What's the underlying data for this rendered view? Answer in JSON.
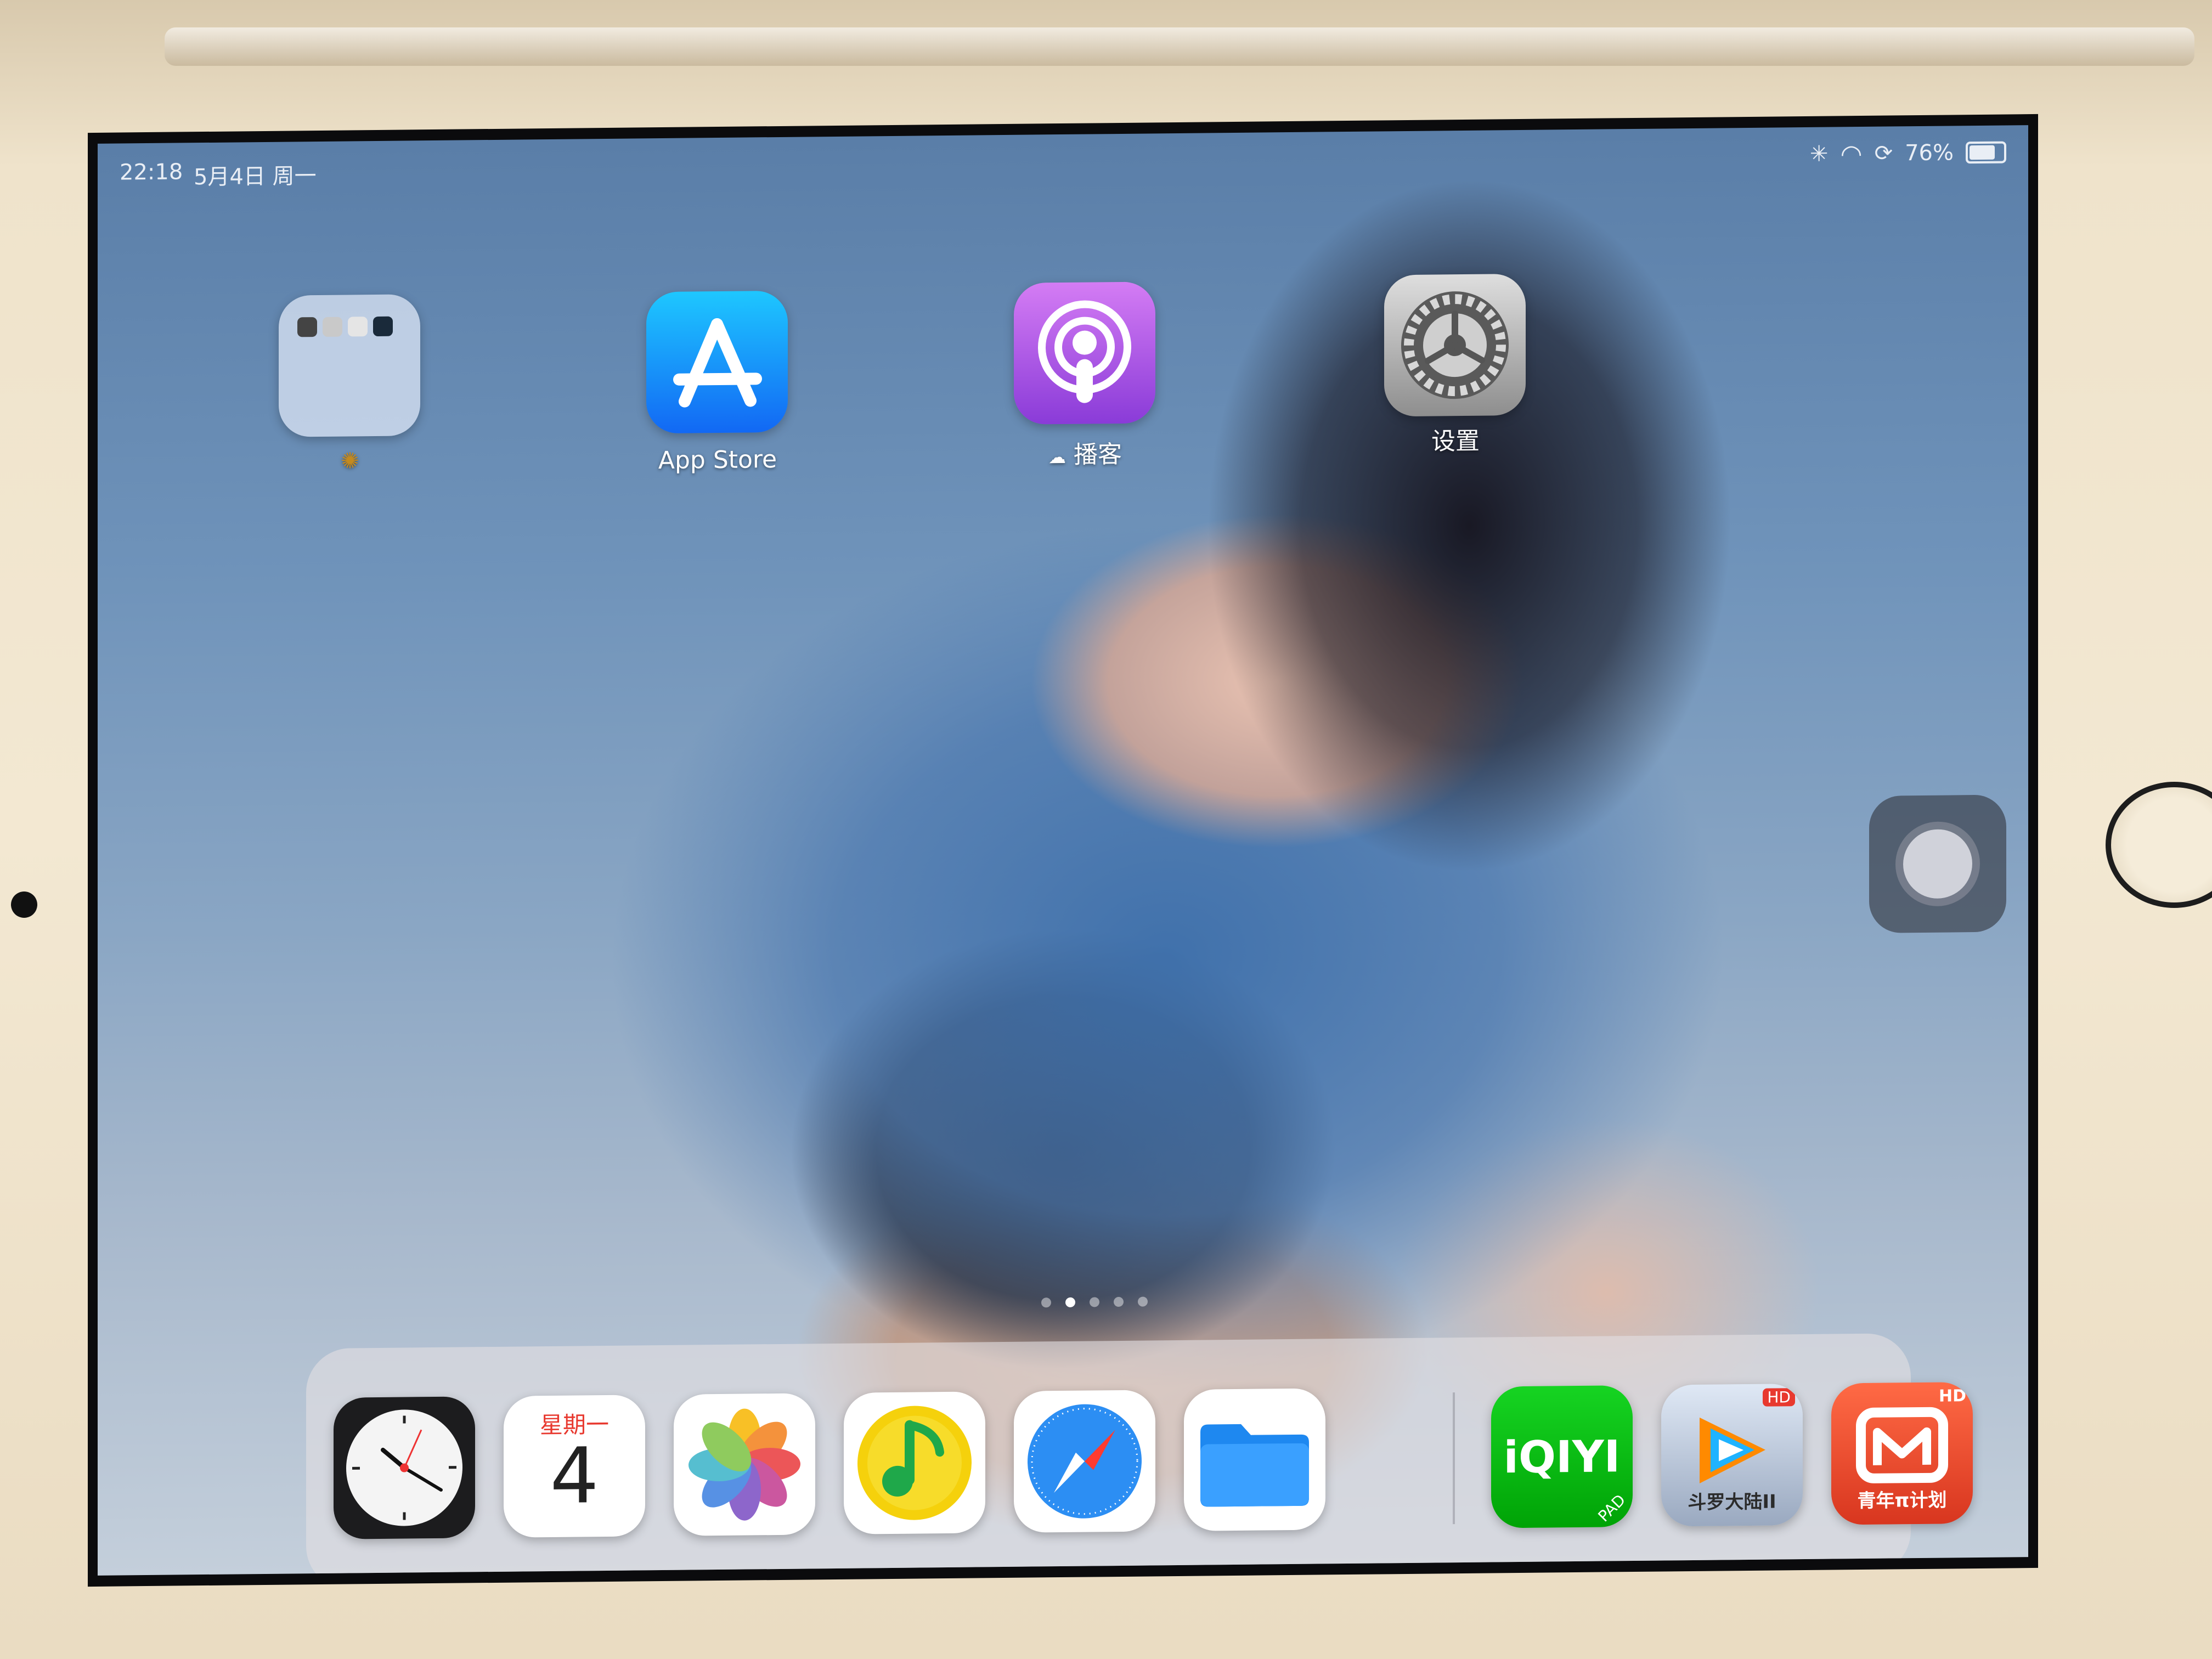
{
  "status_bar": {
    "time": "22:18",
    "date": "5月4日 周一",
    "battery": "76%",
    "battery_level": 0.76
  },
  "home_apps": [
    {
      "label": "",
      "icon": "folder-icon"
    },
    {
      "label": "App Store",
      "icon": "app-store-icon"
    },
    {
      "label": "播客",
      "icon": "podcasts-icon"
    },
    {
      "label": "设置",
      "icon": "settings-gear-icon"
    }
  ],
  "page_indicator": {
    "count": 5,
    "current": 2
  },
  "dock": {
    "calendar_weekday": "星期一",
    "calendar_day": "4",
    "iqiyi_text": "iQIYI",
    "iqiyi_badge": "PAD",
    "tencent_badge": "HD",
    "tencent_caption": "斗罗大陆II",
    "mango_badge": "HD",
    "mango_caption": "青年π计划"
  },
  "colors": {
    "app_store": "#1a8cf8",
    "podcasts": "#a84fe2",
    "settings": "#9a9a9a",
    "files": "#1e88f0",
    "iqiyi": "#00be06",
    "mango": "#e8432f"
  }
}
